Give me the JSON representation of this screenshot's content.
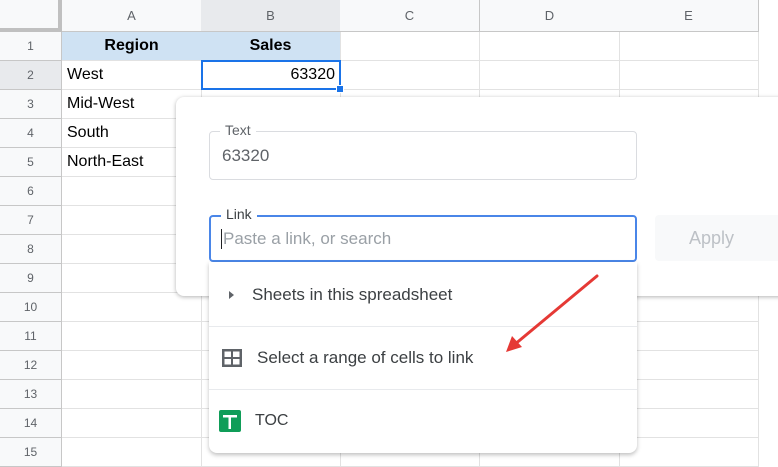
{
  "columns": [
    "A",
    "B",
    "C",
    "D",
    "E"
  ],
  "rows": [
    "1",
    "2",
    "3",
    "4",
    "5",
    "6",
    "7",
    "8",
    "9",
    "10",
    "11",
    "12",
    "13",
    "14",
    "15"
  ],
  "cells": {
    "A1": "Region",
    "B1": "Sales",
    "A2": "West",
    "B2": "63320",
    "A3": "Mid-West",
    "A4": "South",
    "A5": "North-East"
  },
  "popup": {
    "text_label": "Text",
    "text_value": "63320",
    "link_label": "Link",
    "link_placeholder": "Paste a link, or search",
    "apply_label": "Apply",
    "dropdown": {
      "sheets": "Sheets in this spreadsheet",
      "range": "Select a range of cells to link",
      "toc": "TOC"
    }
  },
  "colors": {
    "accent": "#1a73e8",
    "header_fill": "#cfe2f3",
    "arrow": "#e53935",
    "sheet_green": "#0f9d58"
  }
}
